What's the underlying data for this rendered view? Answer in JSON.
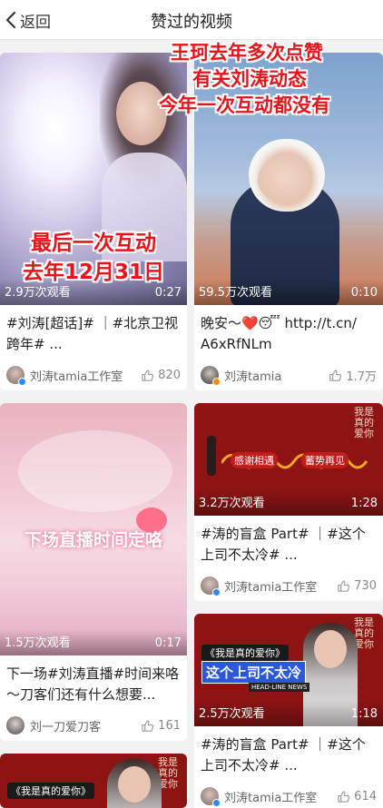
{
  "header": {
    "back_label": "返回",
    "title": "赞过的视频"
  },
  "overlay": {
    "top_right_lines": [
      "王珂去年多次点赞",
      "有关刘涛动态",
      "今年一次互动都没有"
    ],
    "card1_lines": [
      "最后一次互动",
      "去年12月31日"
    ]
  },
  "cards": [
    {
      "views": "2.9万次观看",
      "duration": "0:27",
      "caption": "#刘涛[超话]# ｜#北京卫视跨年# ...",
      "author": "刘涛tamia工作室",
      "likes": "820"
    },
    {
      "views": "59.5万次观看",
      "duration": "0:10",
      "caption_line1": "晚安～❤️😴 http://t.cn/",
      "caption_line2": "A6xRfNLm",
      "author": "刘涛tamia",
      "likes": "1.7万"
    },
    {
      "views": "1.5万次观看",
      "duration": "0:17",
      "caption": "下一场#刘涛直播#时间来咯～刀客们还有什么想要...",
      "author": "刘一刀爱刀客",
      "likes": "161",
      "thumb_text": "下场直播时间定咯"
    },
    {
      "views": "3.2万次观看",
      "duration": "1:28",
      "caption": "#涛的盲盒 Part# ｜#这个上司不太冷# ...",
      "author": "刘涛tamia工作室",
      "likes": "730",
      "thumb_texts": [
        "感谢相遇",
        "蓄势再见"
      ],
      "corner_text": "我是真的爱你"
    },
    {
      "views": "2.5万次观看",
      "duration": "1:18",
      "caption": "#涛的盲盒 Part# ｜#这个上司不太冷# ...",
      "author": "刘涛tamia工作室",
      "likes": "614",
      "badge_top": "《我是真的爱你》",
      "badge_main": "这个上司不太冷",
      "badge_sub": "HEAD-LINE NEWS",
      "corner_text": "我是真的爱你"
    },
    {
      "badge_top": "《我是真的爱你》",
      "corner_text": "我是真的爱你"
    }
  ],
  "colors": {
    "accent_red": "#e8131b",
    "card_red": "#8e1414",
    "verified_blue": "#2e8bff",
    "verified_orange": "#ff8a00"
  }
}
